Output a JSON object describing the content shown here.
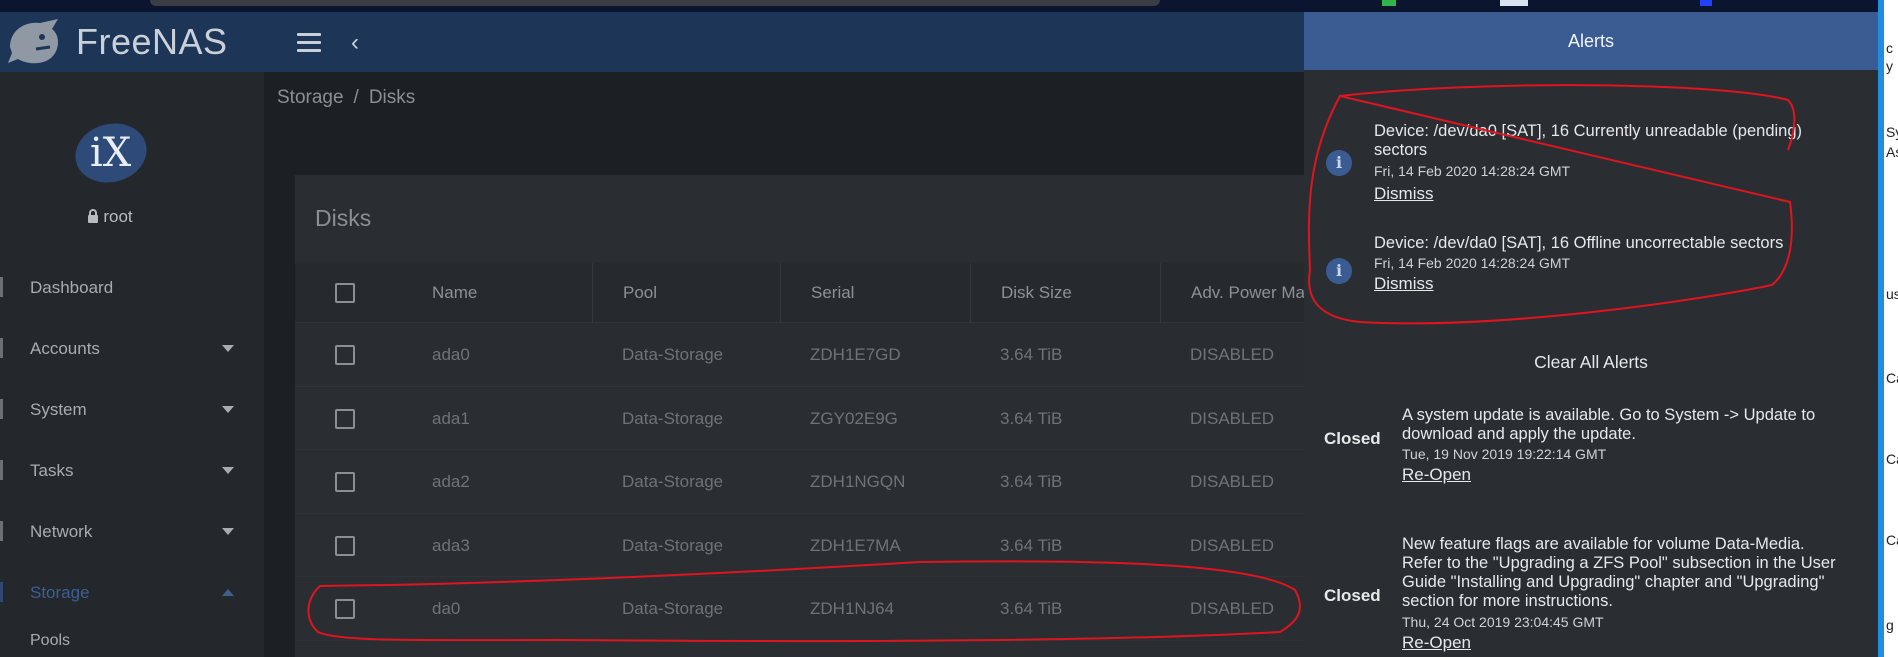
{
  "app": {
    "name": "FreeNAS"
  },
  "sidebar": {
    "user": "root",
    "avatar_text": "iX",
    "items": [
      {
        "label": "Dashboard",
        "expandable": false
      },
      {
        "label": "Accounts",
        "expandable": true
      },
      {
        "label": "System",
        "expandable": true
      },
      {
        "label": "Tasks",
        "expandable": true
      },
      {
        "label": "Network",
        "expandable": true
      },
      {
        "label": "Storage",
        "expandable": true,
        "active": true
      }
    ],
    "sub_item": "Pools"
  },
  "breadcrumb": {
    "part1": "Storage",
    "separator": "/",
    "part2": "Disks"
  },
  "disks": {
    "title": "Disks",
    "columns": [
      "Name",
      "Pool",
      "Serial",
      "Disk Size",
      "Adv. Power Ma"
    ],
    "rows": [
      {
        "name": "ada0",
        "pool": "Data-Storage",
        "serial": "ZDH1E7GD",
        "size": "3.64 TiB",
        "power": "DISABLED"
      },
      {
        "name": "ada1",
        "pool": "Data-Storage",
        "serial": "ZGY02E9G",
        "size": "3.64 TiB",
        "power": "DISABLED"
      },
      {
        "name": "ada2",
        "pool": "Data-Storage",
        "serial": "ZDH1NGQN",
        "size": "3.64 TiB",
        "power": "DISABLED"
      },
      {
        "name": "ada3",
        "pool": "Data-Storage",
        "serial": "ZDH1E7MA",
        "size": "3.64 TiB",
        "power": "DISABLED"
      },
      {
        "name": "da0",
        "pool": "Data-Storage",
        "serial": "ZDH1NJ64",
        "size": "3.64 TiB",
        "power": "DISABLED"
      }
    ]
  },
  "alerts": {
    "title": "Alerts",
    "active": [
      {
        "message": "Device: /dev/da0 [SAT], 16 Currently unreadable (pending) sectors",
        "date": "Fri, 14 Feb 2020 14:28:24 GMT",
        "action": "Dismiss"
      },
      {
        "message": "Device: /dev/da0 [SAT], 16 Offline uncorrectable sectors",
        "date": "Fri, 14 Feb 2020 14:28:24 GMT",
        "action": "Dismiss"
      }
    ],
    "clear_all": "Clear All Alerts",
    "closed": [
      {
        "status": "Closed",
        "message": "A system update is available. Go to System -> Update to download and apply the update.",
        "date": "Tue, 19 Nov 2019 19:22:14 GMT",
        "action": "Re-Open"
      },
      {
        "status": "Closed",
        "message": "New feature flags are available for volume Data-Media. Refer to the \"Upgrading a ZFS Pool\" subsection in the User Guide \"Installing and Upgrading\" chapter and \"Upgrading\" section for more instructions.",
        "date": "Thu, 24 Oct 2019 23:04:45 GMT",
        "action": "Re-Open"
      }
    ]
  },
  "right_edge": {
    "labels": [
      "c",
      "y",
      "Sy",
      "As",
      "us",
      "Ca",
      "Ca",
      "Ca",
      "g"
    ]
  },
  "colors": {
    "header": "#1d3658",
    "alerts_header": "#3a5c93",
    "annotation": "#e0141e",
    "background": "#1c2024"
  },
  "icons": {
    "menu": "hamburger-icon",
    "back": "chevron-left-icon",
    "lock": "lock-icon",
    "info": "info-icon",
    "caret": "caret-down-icon"
  }
}
